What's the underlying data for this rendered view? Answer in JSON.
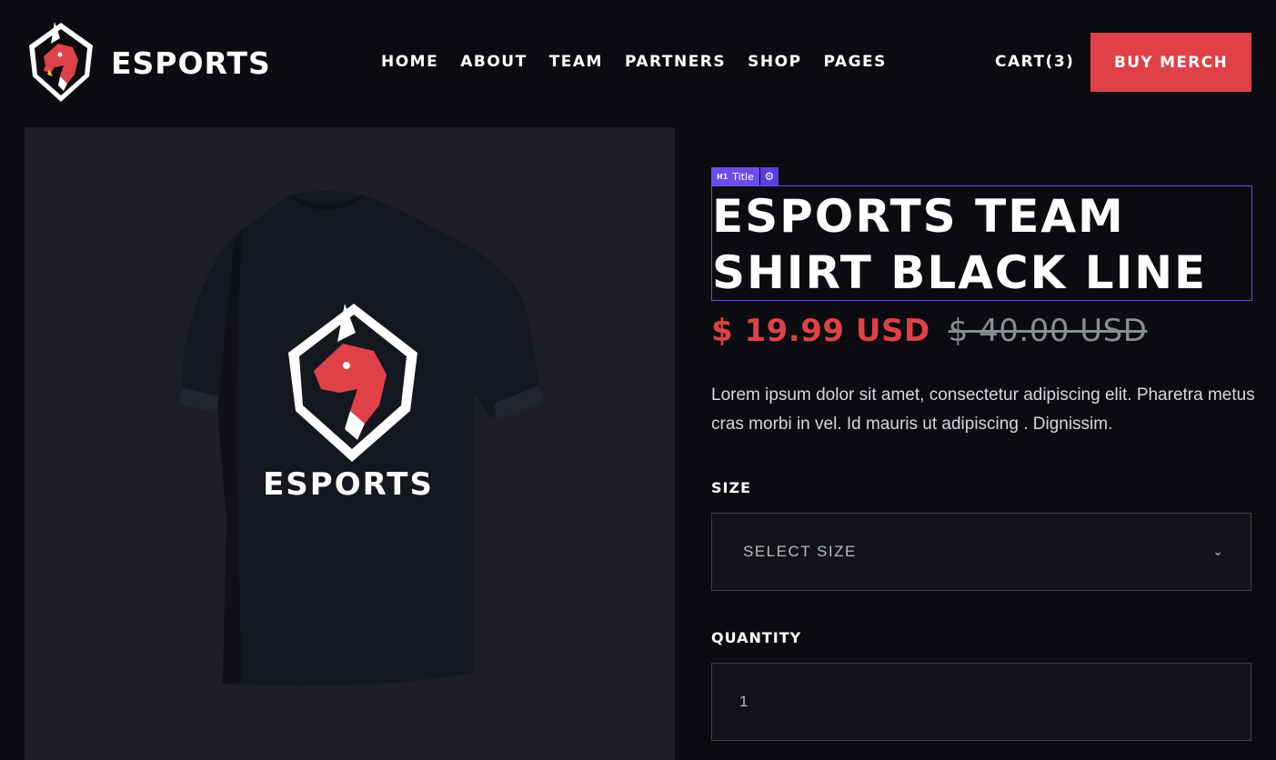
{
  "header": {
    "brand": "ESPORTS",
    "nav": [
      "HOME",
      "ABOUT",
      "TEAM",
      "PARTNERS",
      "SHOP",
      "PAGES"
    ],
    "cart_label": "CART(3)",
    "cta_label": "BUY MERCH"
  },
  "editor_tag": {
    "heading_level": "H1",
    "label": "Title",
    "gear_icon": "gear-icon"
  },
  "product": {
    "title_line1": "ESPORTS TEAM",
    "title_line2": "SHIRT BLACK LINE",
    "sale_price": "$ 19.99 USD",
    "original_price": "$ 40.00 USD",
    "description": "Lorem ipsum dolor sit amet, consectetur adipiscing elit. Pharetra metus cras morbi in vel. Id mauris ut adipiscing . Dignissim.",
    "image_print_text": "ESPORTS",
    "size_label": "SIZE",
    "size_placeholder": "SELECT SIZE",
    "quantity_label": "QUANTITY",
    "quantity_value": "1"
  },
  "colors": {
    "background": "#0a0c10",
    "accent": "#e04147",
    "image_panel": "#1d1f24",
    "editor_highlight": "#6a4cf0"
  }
}
